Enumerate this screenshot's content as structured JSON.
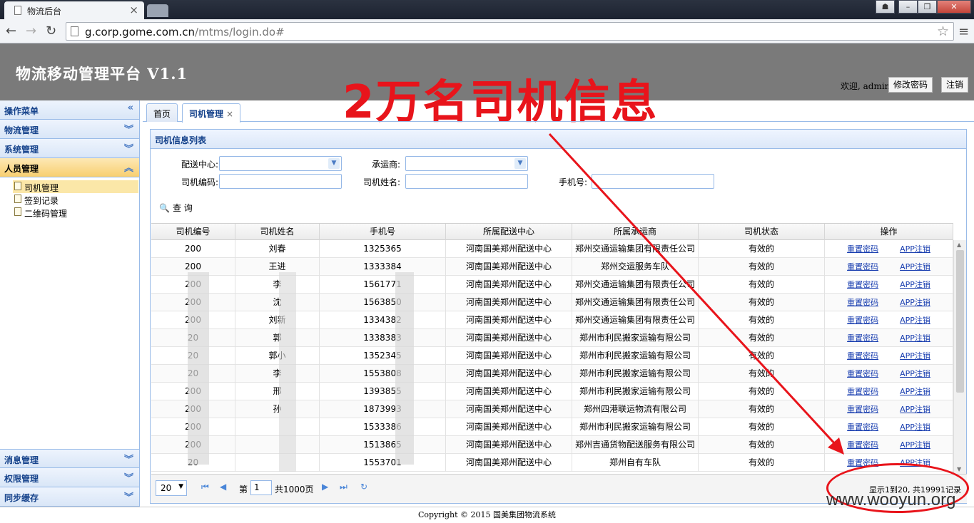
{
  "browser": {
    "tab_title": "物流后台",
    "tab_close": "×",
    "url_host": "g.corp.gome.com.cn",
    "url_path": "/mtms/login.do#"
  },
  "header": {
    "app_title": "物流移动管理平台 V1.1",
    "welcome": "欢迎, admin",
    "change_password": "修改密码",
    "logout": "注销",
    "overlay_headline": "2万名司机信息"
  },
  "sidebar": {
    "menu_title": "操作菜单",
    "sections_top": [
      "物流管理",
      "系统管理",
      "人员管理"
    ],
    "items": [
      "司机管理",
      "签到记录",
      "二维码管理"
    ],
    "sections_bottom": [
      "消息管理",
      "权限管理",
      "同步缓存"
    ]
  },
  "tabs": {
    "home": "首页",
    "driver": "司机管理",
    "driver_close": "×"
  },
  "panel": {
    "title": "司机信息列表",
    "filters": {
      "center": "配送中心:",
      "carrier": "承运商:",
      "driver_code": "司机编码:",
      "driver_name": "司机姓名:",
      "phone": "手机号:"
    },
    "search": "查 询"
  },
  "grid": {
    "columns": [
      "司机编号",
      "司机姓名",
      "手机号",
      "所属配送中心",
      "所属承运商",
      "司机状态",
      "操作"
    ],
    "rows": [
      [
        "200",
        "刘春",
        "1325365",
        "河南国美郑州配送中心",
        "郑州交通运输集团有限责任公司",
        "有效的"
      ],
      [
        "200",
        "王进",
        "1333384",
        "河南国美郑州配送中心",
        "郑州交运服务车队",
        "有效的"
      ],
      [
        "200",
        "李",
        "1561771",
        "河南国美郑州配送中心",
        "郑州交通运输集团有限责任公司",
        "有效的"
      ],
      [
        "200",
        "沈",
        "1563850",
        "河南国美郑州配送中心",
        "郑州交通运输集团有限责任公司",
        "有效的"
      ],
      [
        "200",
        "刘新",
        "1334382",
        "河南国美郑州配送中心",
        "郑州交通运输集团有限责任公司",
        "有效的"
      ],
      [
        "20",
        "郭",
        "1338383",
        "河南国美郑州配送中心",
        "郑州市利民搬家运输有限公司",
        "有效的"
      ],
      [
        "20",
        "郭小",
        "1352345",
        "河南国美郑州配送中心",
        "郑州市利民搬家运输有限公司",
        "有效的"
      ],
      [
        "20",
        "李",
        "1553808",
        "河南国美郑州配送中心",
        "郑州市利民搬家运输有限公司",
        "有效的"
      ],
      [
        "200",
        "邢",
        "1393855",
        "河南国美郑州配送中心",
        "郑州市利民搬家运输有限公司",
        "有效的"
      ],
      [
        "200",
        "孙",
        "1873993",
        "河南国美郑州配送中心",
        "郑州四港联运物流有限公司",
        "有效的"
      ],
      [
        "200",
        "",
        "1533386",
        "河南国美郑州配送中心",
        "郑州市利民搬家运输有限公司",
        "有效的"
      ],
      [
        "200",
        "",
        "1513865",
        "河南国美郑州配送中心",
        "郑州吉通货物配送服务有限公司",
        "有效的"
      ],
      [
        "20",
        "",
        "1553701",
        "河南国美郑州配送中心",
        "郑州自有车队",
        "有效的"
      ]
    ],
    "action_reset": "重置密码",
    "action_logout": "APP注销"
  },
  "pager": {
    "page_size": "20",
    "page_prefix": "第",
    "current_page": "1",
    "page_suffix": "共1000页",
    "record_info": "显示1到20, 共19991记录"
  },
  "footer": "Copyright © 2015 国美集团物流系统",
  "watermark": "www.wooyun.org",
  "colors": {
    "annotation_red": "#e8141b",
    "header_gray": "#7a7a7a",
    "panel_blue": "#99bbe8"
  }
}
